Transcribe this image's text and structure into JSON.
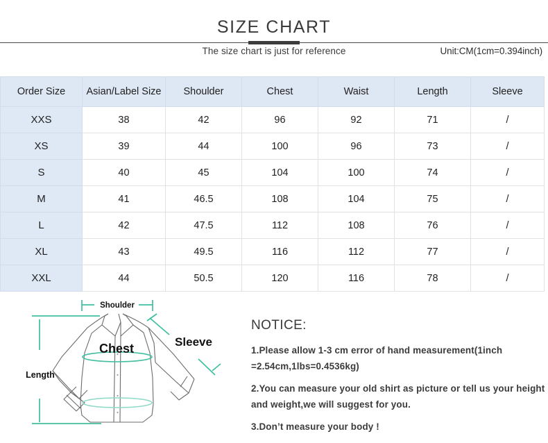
{
  "header": {
    "title": "SIZE CHART",
    "subtitle": "The size chart is just for reference",
    "unit_note": "Unit:CM(1cm=0.394inch)"
  },
  "table": {
    "columns": [
      "Order Size",
      "Asian/Label Size",
      "Shoulder",
      "Chest",
      "Waist",
      "Length",
      "Sleeve"
    ],
    "rows": [
      [
        "XXS",
        "38",
        "42",
        "96",
        "92",
        "71",
        "/"
      ],
      [
        "XS",
        "39",
        "44",
        "100",
        "96",
        "73",
        "/"
      ],
      [
        "S",
        "40",
        "45",
        "104",
        "100",
        "74",
        "/"
      ],
      [
        "M",
        "41",
        "46.5",
        "108",
        "104",
        "75",
        "/"
      ],
      [
        "L",
        "42",
        "47.5",
        "112",
        "108",
        "76",
        "/"
      ],
      [
        "XL",
        "43",
        "49.5",
        "116",
        "112",
        "77",
        "/"
      ],
      [
        "XXL",
        "44",
        "50.5",
        "120",
        "116",
        "78",
        "/"
      ]
    ]
  },
  "diagram": {
    "labels": {
      "shoulder": "Shoulder",
      "chest": "Chest",
      "sleeve": "Sleeve",
      "length": "Length"
    },
    "measure_color": "#3fbfa0",
    "outline_color": "#6b6b6b"
  },
  "notice": {
    "title": "NOTICE:",
    "lines": [
      "1.Please allow 1-3 cm error of hand measurement(1inch =2.54cm,1lbs=0.4536kg)",
      "2.You can measure your old shirt as picture or tell us your height and weight,we will suggest for you.",
      "3.Don’t measure your body !"
    ]
  },
  "colors": {
    "header_bg": "#dde8f4",
    "sizecol_bg": "#dfe9f5",
    "border": "#e2e2e4",
    "title": "#3a3a3a",
    "teal": "#3fbfa0"
  }
}
